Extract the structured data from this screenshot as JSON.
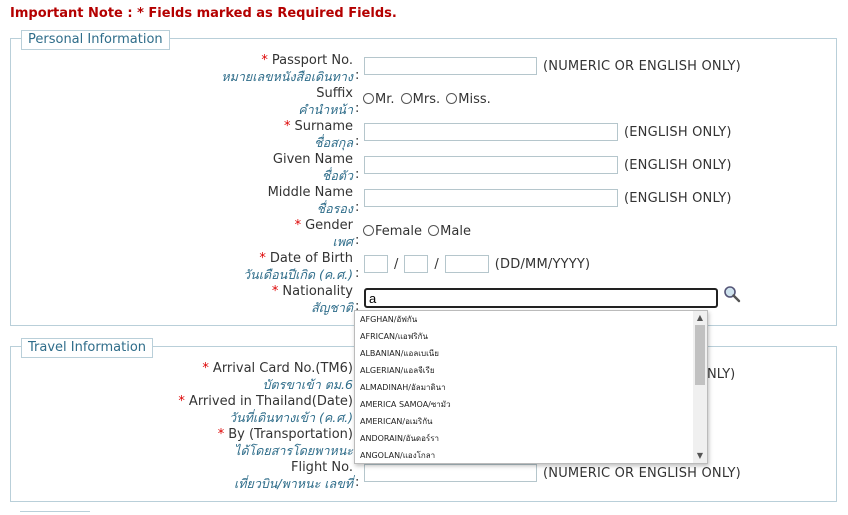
{
  "note": "Important Note : * Fields marked as Required Fields.",
  "personal": {
    "legend": "Personal Information",
    "fields": [
      {
        "required": true,
        "en": "Passport No.",
        "th": "หมายเลขหนังสือเดินทาง",
        "hint": "(NUMERIC OR ENGLISH ONLY)"
      },
      {
        "required": false,
        "en": "Suffix",
        "th": "คำนำหน้า",
        "options": [
          "Mr.",
          "Mrs.",
          "Miss."
        ]
      },
      {
        "required": true,
        "en": "Surname",
        "th": "ชื่อสกุล",
        "hint": "(ENGLISH ONLY)"
      },
      {
        "required": false,
        "en": "Given Name",
        "th": "ชื่อตัว",
        "hint": "(ENGLISH ONLY)"
      },
      {
        "required": false,
        "en": "Middle Name",
        "th": "ชื่อรอง",
        "hint": "(ENGLISH ONLY)"
      },
      {
        "required": true,
        "en": "Gender",
        "th": "เพศ",
        "options": [
          "Female",
          "Male"
        ]
      },
      {
        "required": true,
        "en": "Date of Birth",
        "th": "วันเดือนปีเกิด (ค.ศ.)",
        "separator": "/",
        "hint": "(DD/MM/YYYY)"
      },
      {
        "required": true,
        "en": "Nationality",
        "th": "สัญชาติ",
        "value": "a"
      }
    ],
    "lookup_icon": "search-lookup-icon"
  },
  "nationality_dropdown": {
    "items": [
      "AFGHAN/อัฟกัน",
      "AFRICAN/แอฟริกัน",
      "ALBANIAN/แอลเบเนีย",
      "ALGERIAN/แอลจีเรีย",
      "ALMADINAH/อัลมาดินา",
      "AMERICA SAMOA/ซามัว",
      "AMERICAN/อเมริกัน",
      "ANDORAIN/อันดอร์รา",
      "ANGOLAN/แองโกลา"
    ]
  },
  "travel": {
    "legend": "Travel Information",
    "fields": [
      {
        "required": true,
        "en": "Arrival Card No.(TM6)",
        "th": "บัตรขาเข้า ตม.6"
      },
      {
        "required": true,
        "en": "Arrived in Thailand(Date)",
        "th": "วันที่เดินทางเข้า (ค.ศ.)"
      },
      {
        "required": true,
        "en": "By (Transportation)",
        "th": "ได้โดยสารโดยพาหนะ"
      },
      {
        "required": false,
        "en": "Flight No.",
        "th": "เที่ยวบิน/พาหนะ เลขที่",
        "hint": "(NUMERIC OR ENGLISH ONLY)"
      }
    ],
    "clipped_hint": "NLY)"
  },
  "colon": ":"
}
